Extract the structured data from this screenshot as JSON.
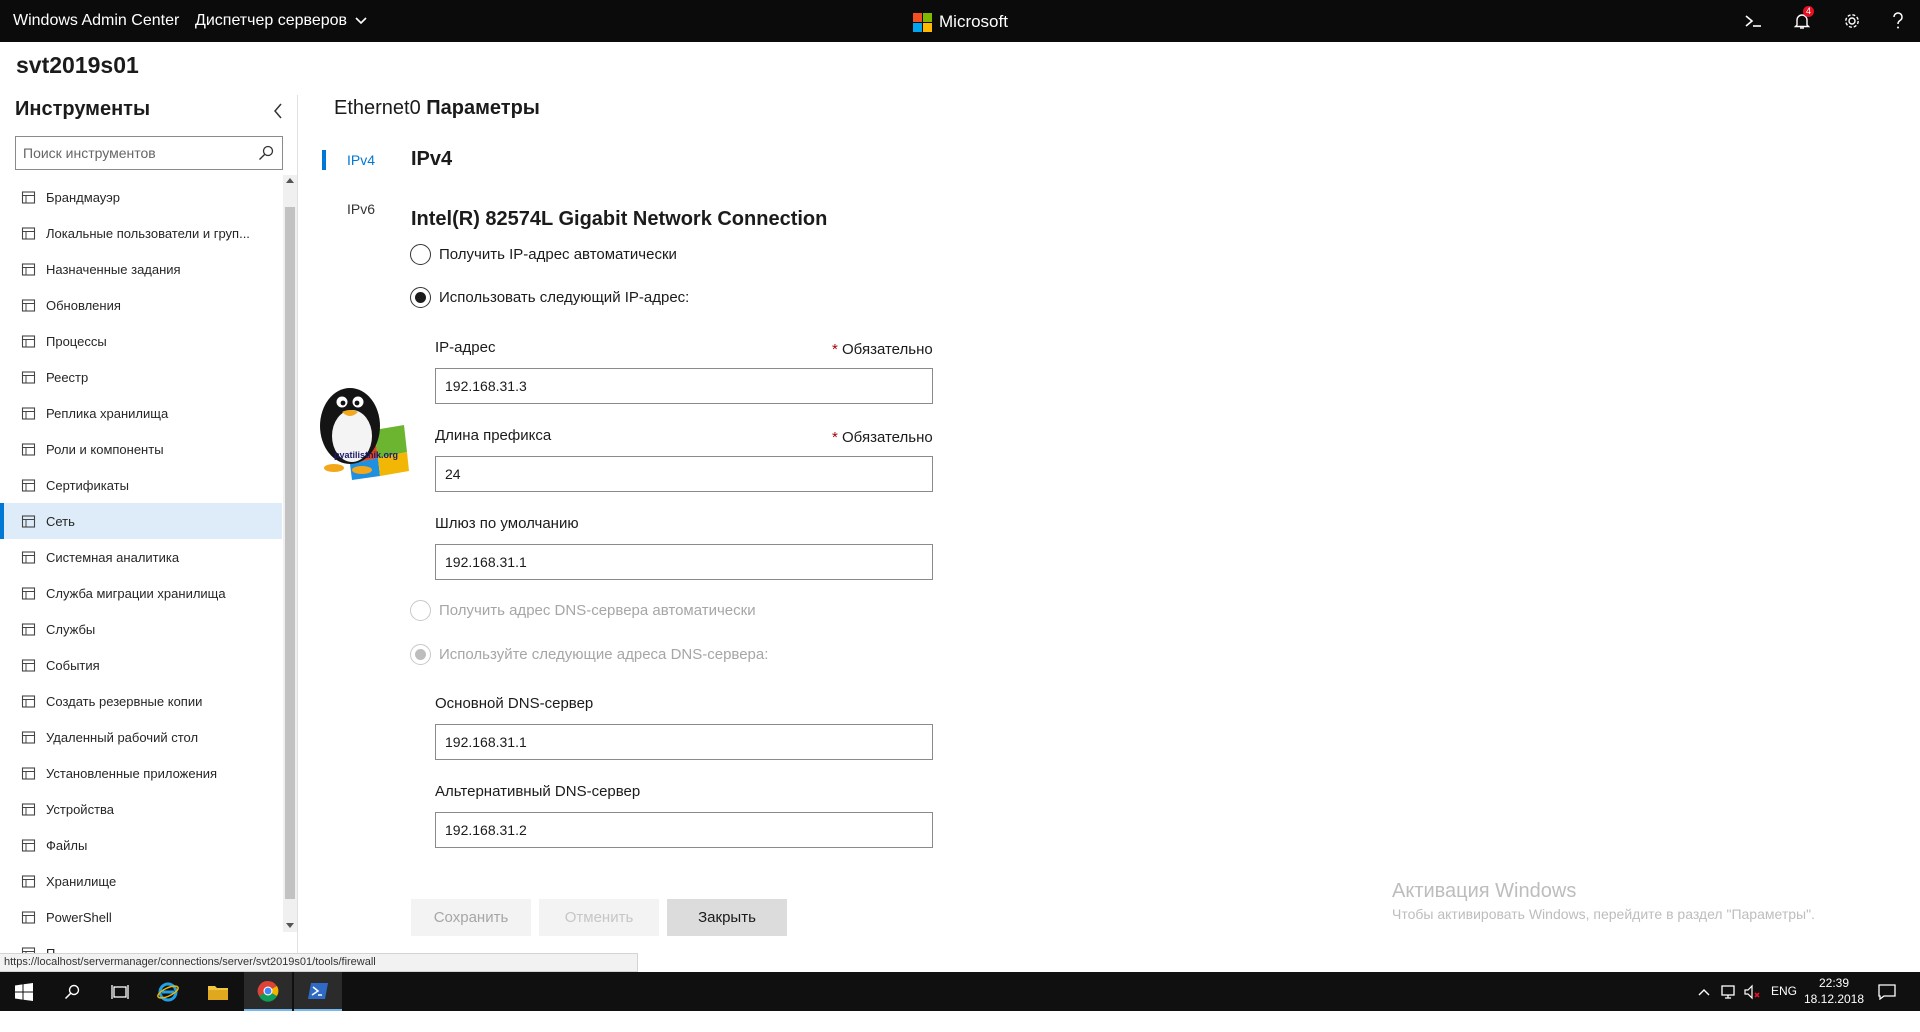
{
  "header": {
    "app_title": "Windows Admin Center",
    "server_manager_menu": "Диспетчер серверов",
    "brand": "Microsoft",
    "notification_count": "4",
    "colors": {
      "ms_red": "#f25022",
      "ms_green": "#7fba00",
      "ms_blue": "#00a4ef",
      "ms_yellow": "#ffb900"
    }
  },
  "server_name": "svt2019s01",
  "sidebar": {
    "title": "Инструменты",
    "search_placeholder": "Поиск инструментов",
    "items": [
      {
        "label": "Брандмауэр",
        "icon": "firewall-icon"
      },
      {
        "label": "Локальные пользователи и груп...",
        "icon": "users-icon"
      },
      {
        "label": "Назначенные задания",
        "icon": "scheduled-tasks-icon"
      },
      {
        "label": "Обновления",
        "icon": "updates-icon"
      },
      {
        "label": "Процессы",
        "icon": "processes-icon"
      },
      {
        "label": "Реестр",
        "icon": "registry-icon"
      },
      {
        "label": "Реплика хранилища",
        "icon": "storage-replica-icon"
      },
      {
        "label": "Роли и компоненты",
        "icon": "roles-icon"
      },
      {
        "label": "Сертификаты",
        "icon": "certificates-icon"
      },
      {
        "label": "Сеть",
        "icon": "network-icon",
        "active": true
      },
      {
        "label": "Системная аналитика",
        "icon": "analytics-icon"
      },
      {
        "label": "Служба миграции хранилища",
        "icon": "migration-icon"
      },
      {
        "label": "Службы",
        "icon": "services-icon"
      },
      {
        "label": "События",
        "icon": "events-icon"
      },
      {
        "label": "Создать резервные копии",
        "icon": "backup-icon"
      },
      {
        "label": "Удаленный рабочий стол",
        "icon": "remote-desktop-icon"
      },
      {
        "label": "Установленные приложения",
        "icon": "apps-icon"
      },
      {
        "label": "Устройства",
        "icon": "devices-icon"
      },
      {
        "label": "Файлы",
        "icon": "files-icon"
      },
      {
        "label": "Хранилище",
        "icon": "storage-icon"
      },
      {
        "label": "PowerShell",
        "icon": "powershell-icon"
      },
      {
        "label": "П",
        "icon": "settings-icon"
      }
    ]
  },
  "main": {
    "heading_nic": "Ethernet0",
    "heading_params": "Параметры",
    "tabs": [
      {
        "label": "IPv4",
        "active": true
      },
      {
        "label": "IPv6",
        "active": false
      }
    ],
    "section_title": "IPv4",
    "adapter": "Intel(R) 82574L Gigabit Network Connection",
    "radio_auto_ip": "Получить IP-адрес автоматически",
    "radio_manual_ip": "Использовать следующий IP-адрес:",
    "required_text": "Обязательно",
    "required_star": "*",
    "ip_label": "IP-адрес",
    "ip_value": "192.168.31.3",
    "prefix_label": "Длина префикса",
    "prefix_value": "24",
    "gateway_label": "Шлюз по умолчанию",
    "gateway_value": "192.168.31.1",
    "radio_auto_dns": "Получить адрес DNS-сервера автоматически",
    "radio_manual_dns": "Используйте следующие адреса DNS-сервера:",
    "dns1_label": "Основной DNS-сервер",
    "dns1_value": "192.168.31.1",
    "dns2_label": "Альтернативный DNS-сервер",
    "dns2_value": "192.168.31.2",
    "buttons": {
      "save": "Сохранить",
      "cancel": "Отменить",
      "close": "Закрыть"
    },
    "watermark_logo": "pyatilistnik.org"
  },
  "activation": {
    "title": "Активация Windows",
    "subtitle": "Чтобы активировать Windows, перейдите в раздел \"Параметры\"."
  },
  "status_url": "https://localhost/servermanager/connections/server/svt2019s01/tools/firewall",
  "taskbar": {
    "language": "ENG",
    "time": "22:39",
    "date": "18.12.2018"
  }
}
